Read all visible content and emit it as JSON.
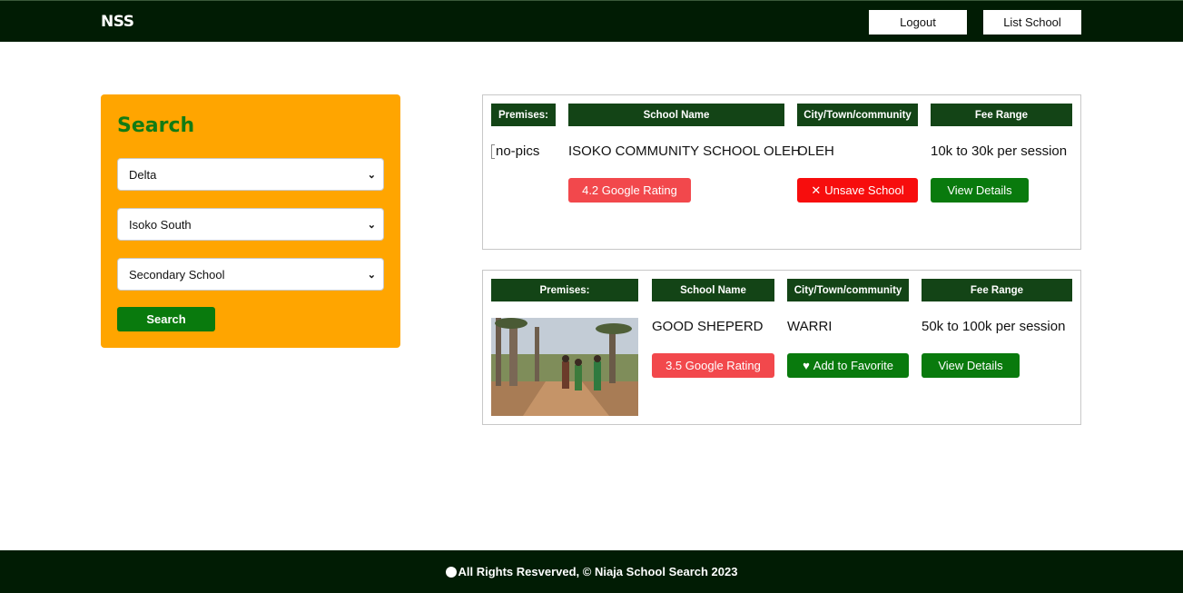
{
  "navbar": {
    "brand": "NSS",
    "logout_label": "Logout",
    "list_school_label": "List School"
  },
  "search": {
    "title": "Search",
    "state_value": "Delta",
    "lga_value": "Isoko South",
    "level_value": "Secondary School",
    "button_label": "Search"
  },
  "table_headers": {
    "premises": "Premises:",
    "school_name": "School Name",
    "city": "City/Town/community",
    "fee_range": "Fee Range"
  },
  "schools": [
    {
      "premises_alt": "no-pics",
      "name": "ISOKO COMMUNITY SCHOOL OLEH",
      "city": "OLEH",
      "fee": "10k to 30k per session",
      "rating": "4.2 Google Rating",
      "favorite_label": "Unsave School",
      "favorite_icon": "x-icon",
      "details_label": "View Details"
    },
    {
      "premises_image": "photo-people-walking-road",
      "name": "GOOD SHEPERD",
      "city": "WARRI",
      "fee": "50k to 100k per session",
      "rating": "3.5 Google Rating",
      "favorite_label": "Add to Favorite",
      "favorite_icon": "heart-icon",
      "details_label": "View Details"
    }
  ],
  "footer": {
    "text": "All Rights Resverved, © Niaja School Search 2023"
  },
  "colors": {
    "navbar_bg": "#011c04",
    "search_panel_bg": "#ffa500",
    "header_bg": "#134416",
    "green_button": "#097a0d",
    "rating_bg": "#f2484c",
    "unsave_bg": "#f70d0d"
  }
}
